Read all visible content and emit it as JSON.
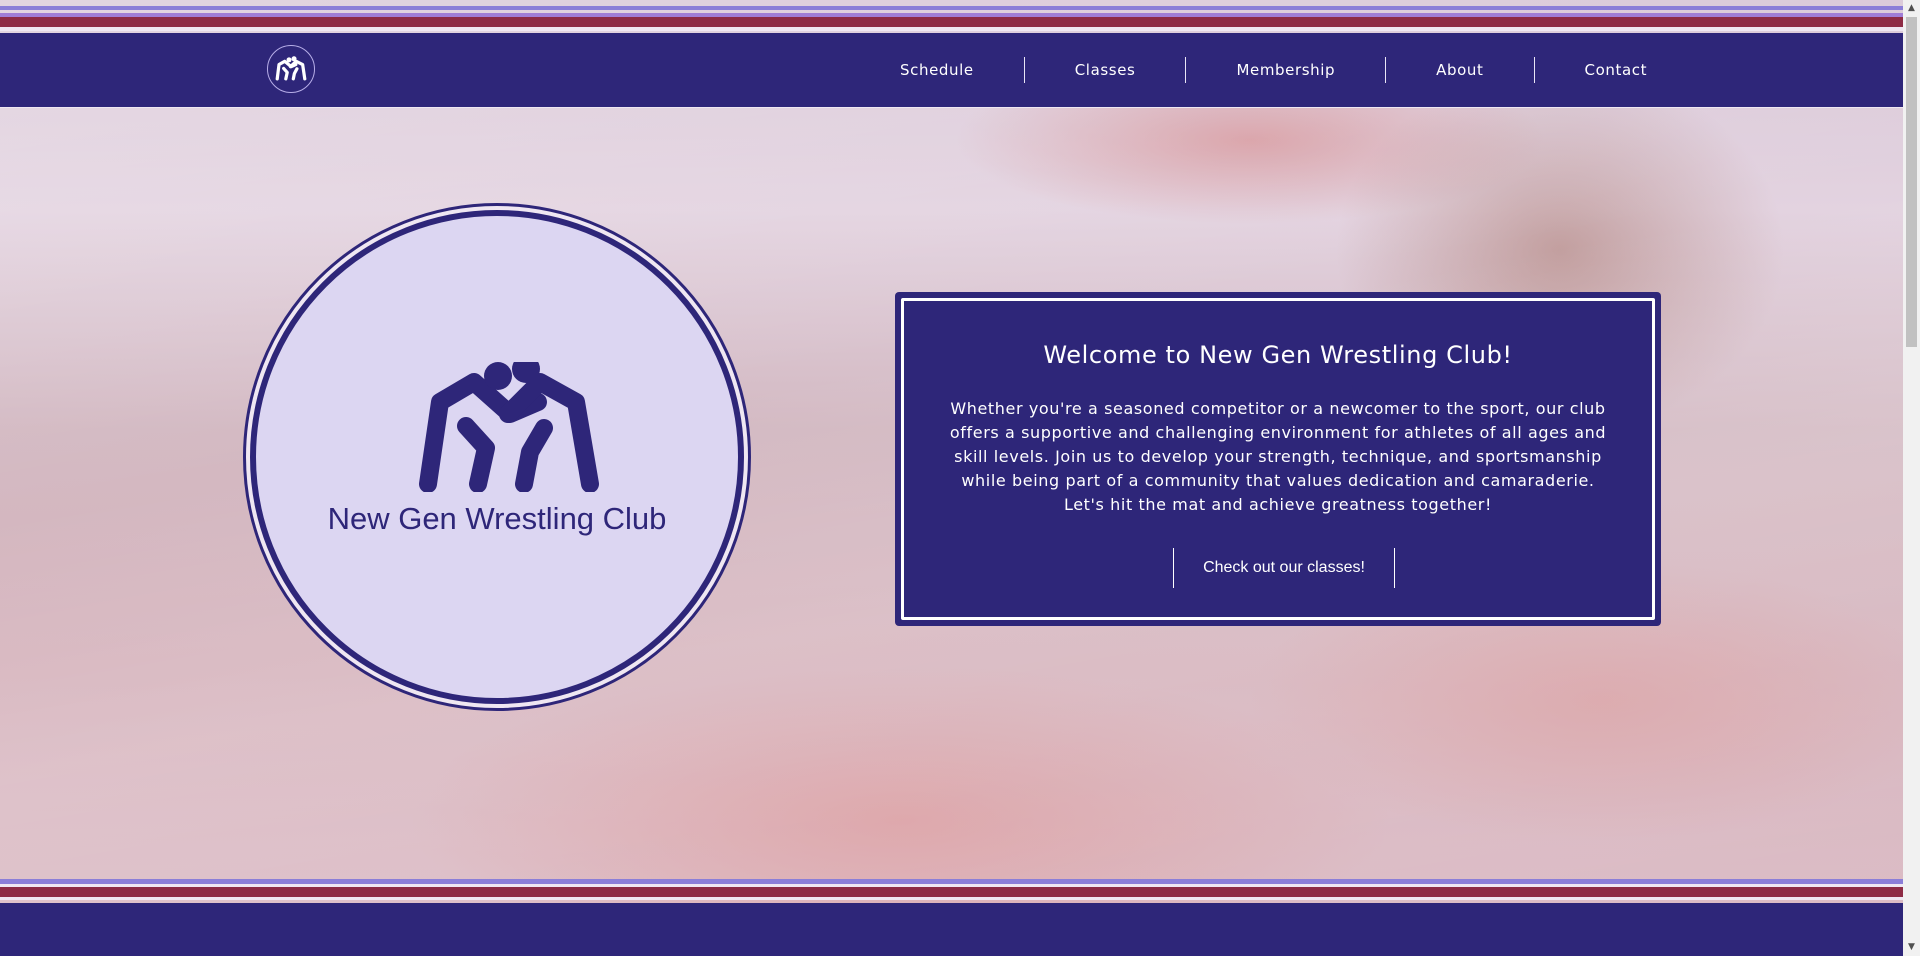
{
  "colors": {
    "primary": "#2e2679",
    "accent_red": "#8e2b45",
    "accent_lavender": "#8b7ed8",
    "emblem_fill": "#dcd6f2",
    "white": "#ffffff"
  },
  "header": {
    "logo_icon": "wrestlers-icon",
    "nav": [
      {
        "label": "Schedule"
      },
      {
        "label": "Classes"
      },
      {
        "label": "Membership"
      },
      {
        "label": "About"
      },
      {
        "label": "Contact"
      }
    ]
  },
  "emblem": {
    "icon": "wrestlers-icon",
    "title": "New Gen Wrestling Club"
  },
  "welcome": {
    "title": "Welcome to New Gen Wrestling Club!",
    "text": "Whether you're a seasoned competitor or a newcomer to the sport, our club offers a supportive and challenging environment for athletes of all ages and skill levels. Join us to develop your strength, technique, and sportsmanship while being part of a community that values dedication and camaraderie. Let's hit the mat and achieve greatness together!",
    "cta_label": "Check out our classes!"
  },
  "scrollbar": {
    "up_icon": "scroll-up-arrow-icon",
    "down_icon": "scroll-down-arrow-icon"
  }
}
